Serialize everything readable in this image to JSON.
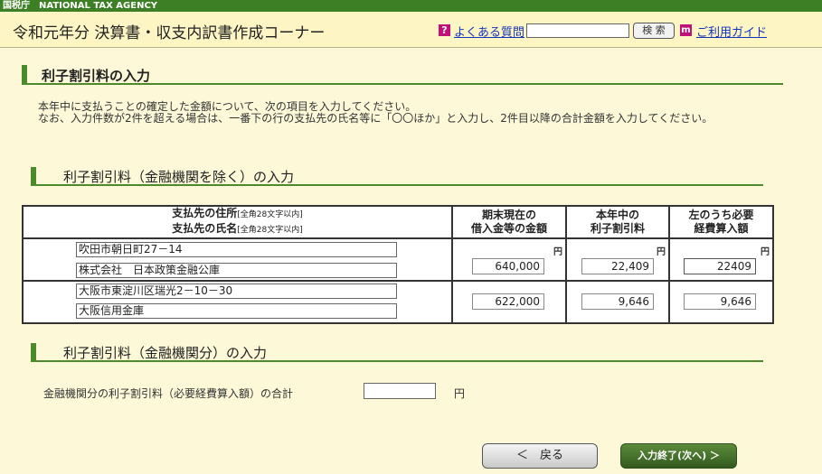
{
  "header": {
    "agency": "国税庁　NATIONAL TAX AGENCY",
    "app_title": "令和元年分 決算書・収支内訳書作成コーナー",
    "faq_icon": "?",
    "faq_label": "よくある質問",
    "search_placeholder": "",
    "search_button": "検 索",
    "guide_icon": "m",
    "guide_label": "ご利用ガイド"
  },
  "page": {
    "title": "利子割引料の入力",
    "intro_line1": "本年中に支払うことの確定した金額について、次の項目を入力してください。",
    "intro_line2": "なお、入力件数が2件を超える場合は、一番下の行の支払先の氏名等に「〇〇ほか」と入力し、2件目以降の合計金額を入力してください。"
  },
  "section1": {
    "title": "利子割引料（金融機関を除く）の入力",
    "columns": {
      "address_label": "支払先の住所",
      "address_note": "[全角28文字以内]",
      "name_label": "支払先の氏名",
      "name_note": "[全角28文字以内]",
      "balance_line1": "期末現在の",
      "balance_line2": "借入金等の金額",
      "interest_line1": "本年中の",
      "interest_line2": "利子割引料",
      "expense_line1": "左のうち必要",
      "expense_line2": "経費算入額"
    },
    "yen": "円",
    "rows": [
      {
        "address": "吹田市朝日町27－14",
        "name": "株式会社　日本政策金融公庫",
        "balance": "640,000",
        "interest": "22,409",
        "expense": "22409"
      },
      {
        "address": "大阪市東淀川区瑞光2－10－30",
        "name": "大阪信用金庫",
        "balance": "622,000",
        "interest": "9,646",
        "expense": "9,646"
      }
    ]
  },
  "section2": {
    "title": "利子割引料（金融機関分）の入力",
    "total_label": "金融機関分の利子割引料（必要経費算入額）の合計",
    "total_value": "",
    "unit": "円"
  },
  "footer": {
    "back_label": "＜　戻る",
    "next_label": "入力終了(次へ) ＞"
  },
  "colors": {
    "background": "#fdf8d8",
    "brand_green": "#3d7f24",
    "accent_magenta": "#c0117a",
    "link_blue": "#1133bb"
  }
}
